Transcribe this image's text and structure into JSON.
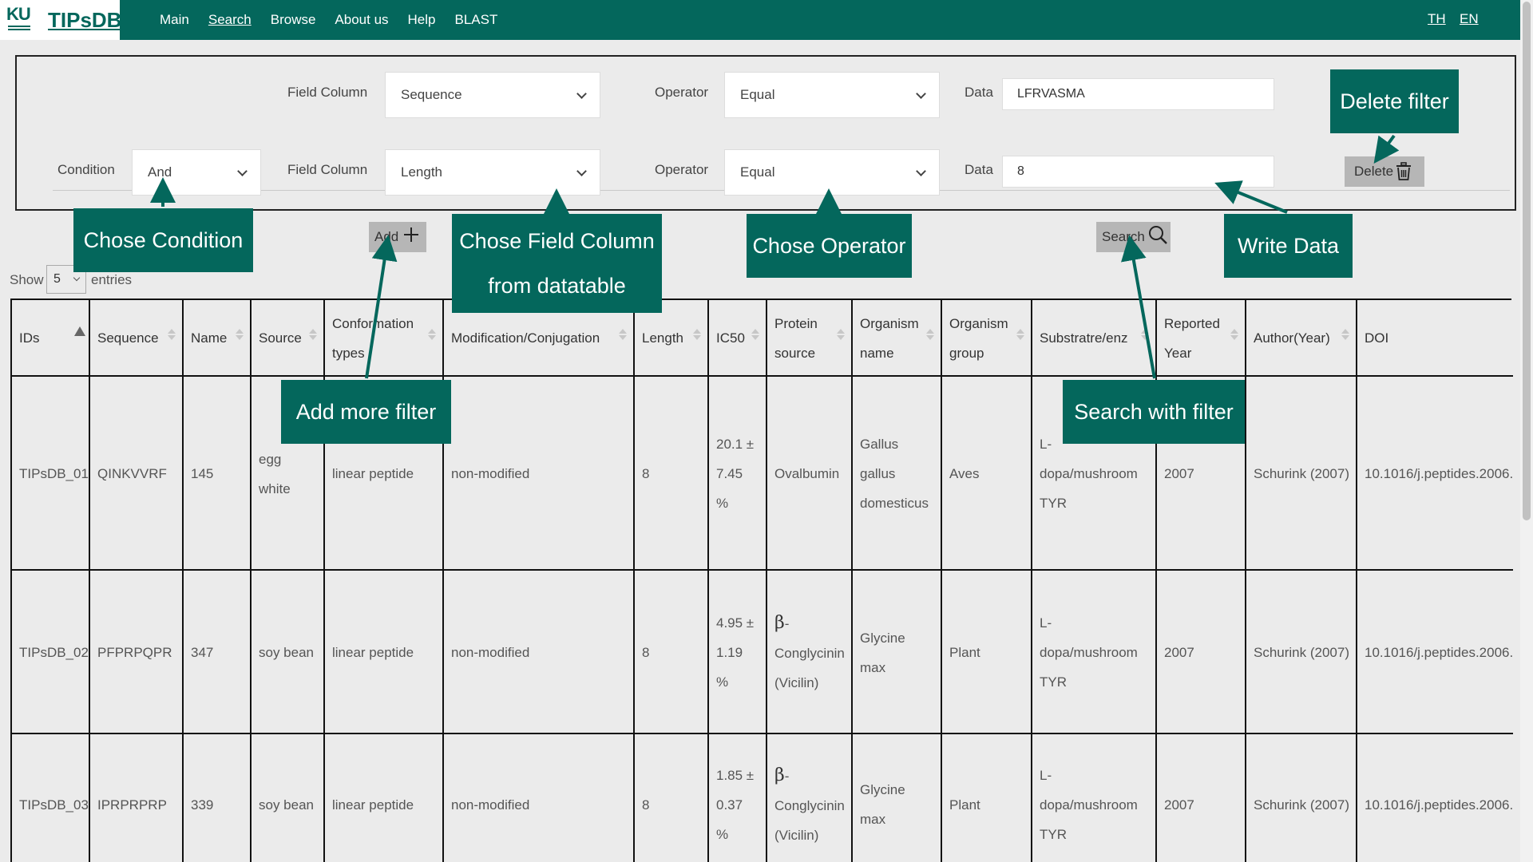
{
  "header": {
    "logo_text": "KU",
    "brand": "TIPsDB",
    "nav": [
      "Main",
      "Search",
      "Browse",
      "About us",
      "Help",
      "BLAST"
    ],
    "active_nav": "Search",
    "lang": [
      "TH",
      "EN"
    ]
  },
  "filter": {
    "row1": {
      "field_column_label": "Field Column",
      "field_column_value": "Sequence",
      "operator_label": "Operator",
      "operator_value": "Equal",
      "data_label": "Data",
      "data_value": "LFRVASMA"
    },
    "row2": {
      "condition_label": "Condition",
      "condition_value": "And",
      "field_column_label": "Field Column",
      "field_column_value": "Length",
      "operator_label": "Operator",
      "operator_value": "Equal",
      "data_label": "Data",
      "data_value": "8",
      "delete_label": "Delete"
    },
    "add_label": "Add",
    "search_label": "Search"
  },
  "entries": {
    "show": "Show",
    "value": "5",
    "suffix": "entries"
  },
  "table": {
    "headers": [
      [
        "IDs"
      ],
      [
        "Sequence"
      ],
      [
        "Name"
      ],
      [
        "Source"
      ],
      [
        "Conformation",
        "types"
      ],
      [
        "Modification/Conjugation"
      ],
      [
        "Length"
      ],
      [
        "IC50"
      ],
      [
        "Protein",
        "source"
      ],
      [
        "Organism",
        "name"
      ],
      [
        "Organism",
        "group"
      ],
      [
        "Substratre/enz"
      ],
      [
        "Reported",
        "Year"
      ],
      [
        "Author(Year)"
      ],
      [
        "DOI"
      ]
    ],
    "rows": [
      {
        "id": "TIPsDB_01",
        "sequence": "QINKVVRF",
        "name": "145",
        "source": [
          "egg",
          "white"
        ],
        "conformation": "linear peptide",
        "modification": "non-modified",
        "length": "8",
        "ic50": [
          "20.1 ±",
          "7.45",
          "%"
        ],
        "protein": [
          "Ovalbumin"
        ],
        "protein_beta": false,
        "organism": [
          "Gallus",
          "gallus",
          "domesticus"
        ],
        "group": "Aves",
        "substrate": [
          "L-",
          "dopa/mushroom",
          "TYR"
        ],
        "year": "2007",
        "author": "Schurink (2007)",
        "doi": "10.1016/j.peptides.2006."
      },
      {
        "id": "TIPsDB_02",
        "sequence": "PFPRPQPR",
        "name": "347",
        "source": [
          "soy bean"
        ],
        "conformation": "linear peptide",
        "modification": "non-modified",
        "length": "8",
        "ic50": [
          "4.95 ±",
          "1.19",
          "%"
        ],
        "protein": [
          "β-",
          "Conglycinin",
          "(Vicilin)"
        ],
        "protein_beta": true,
        "organism": [
          "Glycine",
          "max"
        ],
        "group": "Plant",
        "substrate": [
          "L-",
          "dopa/mushroom",
          "TYR"
        ],
        "year": "2007",
        "author": "Schurink (2007)",
        "doi": "10.1016/j.peptides.2006."
      },
      {
        "id": "TIPsDB_03",
        "sequence": "IPRPRPRP",
        "name": "339",
        "source": [
          "soy bean"
        ],
        "conformation": "linear peptide",
        "modification": "non-modified",
        "length": "8",
        "ic50": [
          "1.85 ±",
          "0.37",
          "%"
        ],
        "protein": [
          "β-",
          "Conglycinin",
          "(Vicilin)"
        ],
        "protein_beta": true,
        "organism": [
          "Glycine",
          "max"
        ],
        "group": "Plant",
        "substrate": [
          "L-",
          "dopa/mushroom",
          "TYR"
        ],
        "year": "2007",
        "author": "Schurink (2007)",
        "doi": "10.1016/j.peptides.2006."
      }
    ]
  },
  "callouts": {
    "delete_filter": "Delete filter",
    "chose_condition": "Chose Condition",
    "chose_field": [
      "Chose Field Column",
      "from datatable"
    ],
    "chose_operator": "Chose Operator",
    "write_data": "Write Data",
    "add_more": "Add more filter",
    "search_with": "Search with filter"
  },
  "colors": {
    "brand_teal": "#04675c",
    "button_grey": "#b6b6b6",
    "page_bg": "#ebebeb"
  }
}
